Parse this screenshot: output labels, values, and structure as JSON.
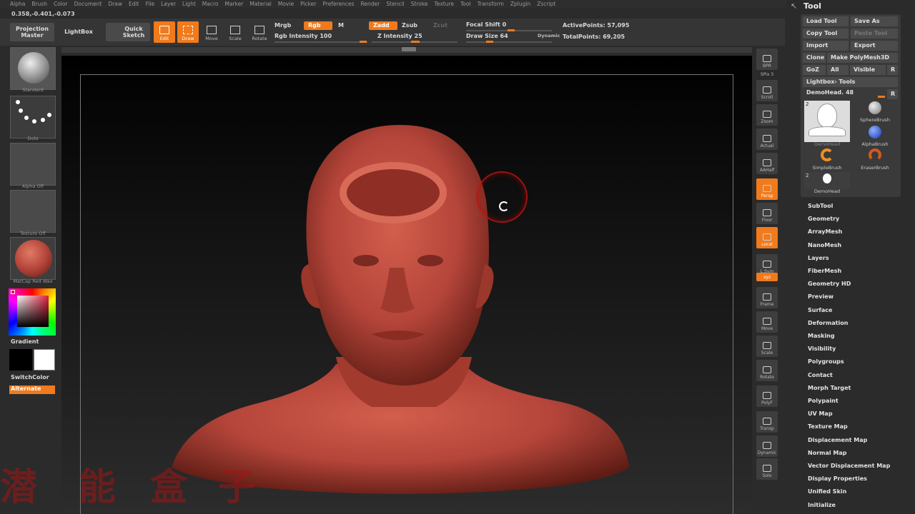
{
  "menu": [
    "Alpha",
    "Brush",
    "Color",
    "Document",
    "Draw",
    "Edit",
    "File",
    "Layer",
    "Light",
    "Macro",
    "Marker",
    "Material",
    "Movie",
    "Picker",
    "Preferences",
    "Render",
    "Stencil",
    "Stroke",
    "Texture",
    "Tool",
    "Transform",
    "Zplugin",
    "Zscript"
  ],
  "coords": "0.358,-0.401,-0.073",
  "toolbar": {
    "projection_master": "Projection Master",
    "lightbox": "LightBox",
    "quick_sketch": "Quick Sketch",
    "edit": "Edit",
    "draw": "Draw",
    "move": "Move",
    "scale": "Scale",
    "rotate": "Rotate",
    "mrgb": "Mrgb",
    "rgb": "Rgb",
    "m": "M",
    "rgb_intensity": "Rgb Intensity 100",
    "zadd": "Zadd",
    "zsub": "Zsub",
    "zcut": "Zcut",
    "z_intensity": "Z Intensity 25",
    "focal_shift": "Focal Shift 0",
    "draw_size": "Draw Size 64",
    "dynamic": "Dynamic",
    "active_points": "ActivePoints: 57,095",
    "total_points": "TotalPoints: 69,205"
  },
  "left_panel": {
    "standard": "Standard",
    "dots": "Dots",
    "alpha_off": "Alpha Off",
    "texture_off": "Texture Off",
    "matcap": "MatCap Red Wax",
    "gradient": "Gradient",
    "switch_color": "SwitchColor",
    "alternate": "Alternate"
  },
  "shelf": [
    "BPR",
    "SPix 3",
    "Scroll",
    "Zoom",
    "Actual",
    "AAHalf",
    "Persp",
    "Floor",
    "Local",
    "L.Sym",
    "xyz",
    "Frame",
    "Move",
    "Scale",
    "Rotate",
    "PolyF",
    "Transp",
    "Dynamic",
    "Solo"
  ],
  "tool_panel": {
    "title": "Tool",
    "load_tool": "Load Tool",
    "save_as": "Save As",
    "copy_tool": "Copy Tool",
    "paste_tool": "Paste Tool",
    "import": "Import",
    "export": "Export",
    "clone": "Clone",
    "make_polymesh": "Make PolyMesh3D",
    "goz": "GoZ",
    "all": "All",
    "visible": "Visible",
    "r": "R",
    "lightbox_tools": "Lightbox› Tools",
    "demohead_slider": "DemoHead. 48",
    "demohead": "DemoHead",
    "spherebrush": "SphereBrush",
    "alphabrush": "AlphaBrush",
    "simplebrush": "SimpleBrush",
    "eraserbrush": "EraserBrush",
    "demohead2": "DemoHead",
    "count_a": "2",
    "count_b": "2"
  },
  "subtools": [
    "SubTool",
    "Geometry",
    "ArrayMesh",
    "NanoMesh",
    "Layers",
    "FiberMesh",
    "Geometry HD",
    "Preview",
    "Surface",
    "Deformation",
    "Masking",
    "Visibility",
    "Polygroups",
    "Contact",
    "Morph Target",
    "Polypaint",
    "UV Map",
    "Texture Map",
    "Displacement Map",
    "Normal Map",
    "Vector Displacement Map",
    "Display Properties",
    "Unified Skin",
    "Initialize"
  ],
  "watermark": [
    "潜",
    "能",
    "盒",
    "子"
  ],
  "colors": {
    "accent": "#f07a1c",
    "wax": "#b5453a"
  }
}
